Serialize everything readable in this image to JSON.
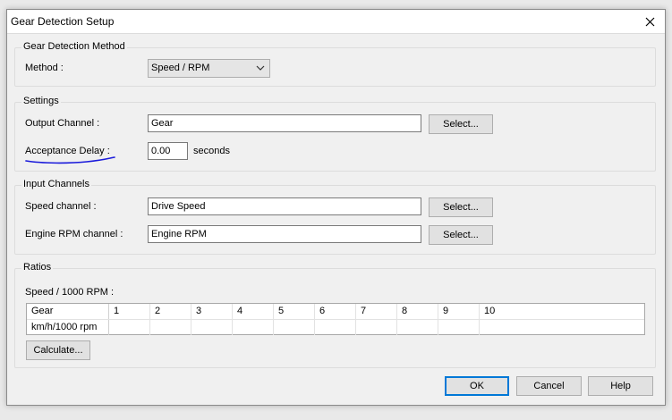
{
  "dialog": {
    "title": "Gear Detection Setup"
  },
  "method_group": {
    "title": "Gear Detection Method",
    "method_label": "Method :",
    "method_value": "Speed / RPM"
  },
  "settings_group": {
    "title": "Settings",
    "output_label": "Output Channel :",
    "output_value": "Gear",
    "output_select": "Select...",
    "delay_label": "Acceptance Delay :",
    "delay_value": "0.00",
    "delay_unit": "seconds"
  },
  "input_group": {
    "title": "Input Channels",
    "speed_label": "Speed channel :",
    "speed_value": "Drive Speed",
    "speed_select": "Select...",
    "rpm_label": "Engine RPM channel :",
    "rpm_value": "Engine RPM",
    "rpm_select": "Select..."
  },
  "ratios_group": {
    "title": "Ratios",
    "subtitle": "Speed / 1000 RPM :",
    "row_headers": [
      "Gear",
      "km/h/1000 rpm"
    ],
    "columns": [
      "1",
      "2",
      "3",
      "4",
      "5",
      "6",
      "7",
      "8",
      "9",
      "10"
    ],
    "values": [
      "",
      "",
      "",
      "",
      "",
      "",
      "",
      "",
      "",
      ""
    ],
    "calculate": "Calculate..."
  },
  "footer": {
    "ok": "OK",
    "cancel": "Cancel",
    "help": "Help"
  },
  "icons": {
    "close": "close-icon",
    "dropdown": "chevron-down-icon"
  },
  "colors": {
    "annotation": "#1a1adb",
    "focus": "#0078d7"
  }
}
